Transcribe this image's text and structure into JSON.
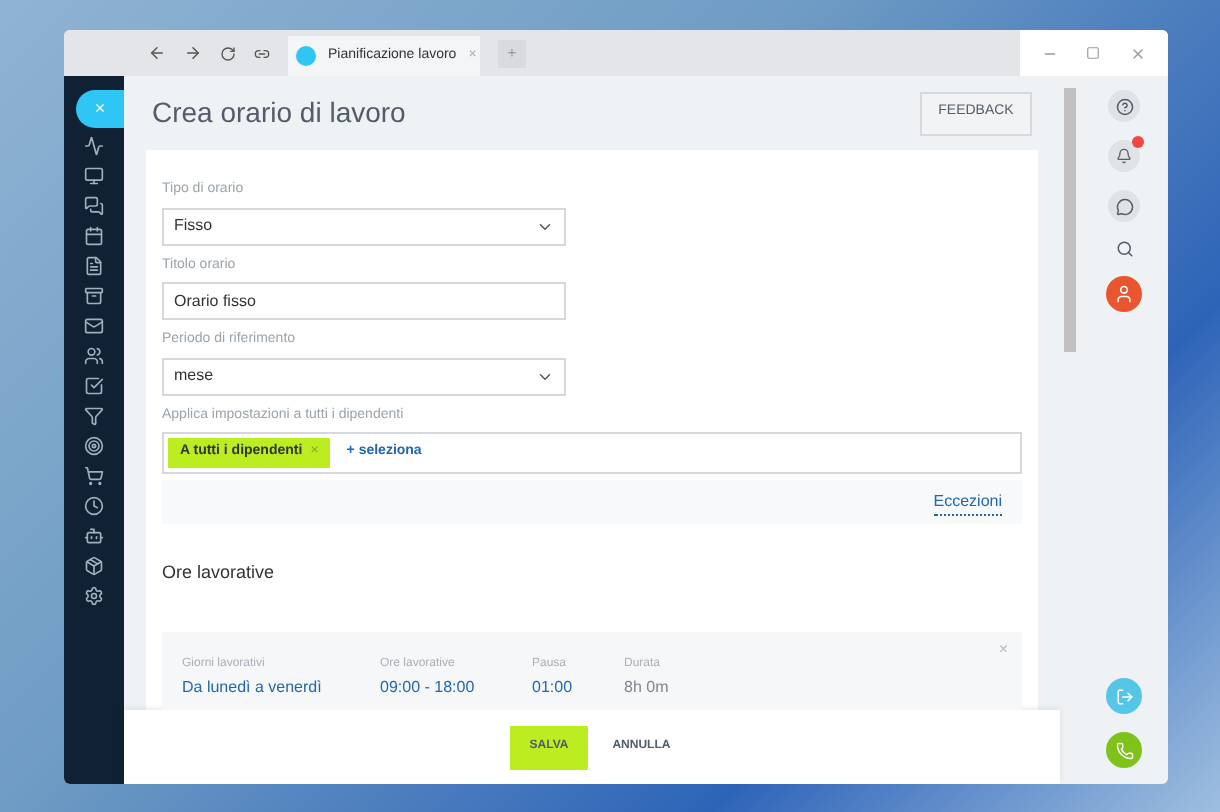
{
  "browser": {
    "tab": {
      "title": "Pianificazione lavoro",
      "close": "×"
    },
    "new_tab": "+"
  },
  "page": {
    "title": "Crea orario di lavoro",
    "feedback_button": "FEEDBACK",
    "close_button": "×"
  },
  "form": {
    "fields": [
      {
        "kind": "select",
        "label": "Tipo di orario",
        "value": "Fisso"
      },
      {
        "kind": "text",
        "label": "Titolo orario",
        "value": "Orario fisso"
      },
      {
        "kind": "select",
        "label": "Periodo di riferimento",
        "value": "mese"
      }
    ],
    "assign": {
      "label": "Applica impostazioni a tutti i dipendenti",
      "tag": "A tutti i dipendenti",
      "tag_remove": "×",
      "add_link": "+ seleziona"
    },
    "exceptions_link": "Eccezioni"
  },
  "working_hours": {
    "title": "Ore lavorative",
    "remove": "×",
    "columns": [
      {
        "label": "Giorni lavorativi",
        "value": "Da lunedì a venerdì",
        "link": true
      },
      {
        "label": "Ore lavorative",
        "value": "09:00 - 18:00",
        "link": true
      },
      {
        "label": "Pausa",
        "value": "01:00",
        "link": true
      },
      {
        "label": "Durata",
        "value": "8h 0m",
        "link": false
      }
    ]
  },
  "footer": {
    "save": "SALVA",
    "cancel": "ANNULLA"
  },
  "right_panel": {
    "notifications": {
      "unread": true
    }
  }
}
